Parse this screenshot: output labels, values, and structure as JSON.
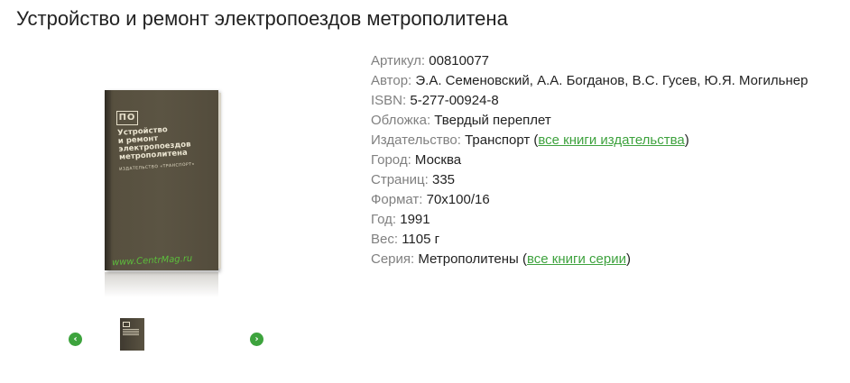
{
  "page": {
    "title": "Устройство и ремонт электропоездов метрополитена"
  },
  "cover": {
    "logo_text": "ПО",
    "title_lines": [
      "Устройство",
      "и ремонт",
      "электропоездов",
      "метрополитена"
    ],
    "publisher": "ИЗДАТЕЛЬСТВО «ТРАНСПОРТ»",
    "watermark": "www.CentrMag.ru"
  },
  "gallery": {
    "prev_icon": "chevron-left-icon",
    "next_icon": "chevron-right-icon",
    "prev_glyph": "‹",
    "next_glyph": "›"
  },
  "attributes": {
    "article": {
      "label": "Артикул:",
      "value": "00810077"
    },
    "author": {
      "label": "Автор:",
      "value": "Э.А. Семеновский, А.А. Богданов, В.С. Гусев, Ю.Я. Могильнер"
    },
    "isbn": {
      "label": "ISBN:",
      "value": "5-277-00924-8"
    },
    "cover": {
      "label": "Обложка:",
      "value": "Твердый переплет"
    },
    "publisher": {
      "label": "Издательство:",
      "value": "Транспорт",
      "link": "все книги издательства"
    },
    "city": {
      "label": "Город:",
      "value": "Москва"
    },
    "pages": {
      "label": "Страниц:",
      "value": "335"
    },
    "format": {
      "label": "Формат:",
      "value": "70x100/16"
    },
    "year": {
      "label": "Год:",
      "value": "1991"
    },
    "weight": {
      "label": "Вес:",
      "value": "1105 г"
    },
    "series": {
      "label": "Серия:",
      "value": "Метрополитены",
      "link": "все книги серии"
    }
  },
  "colors": {
    "link": "#3ea23e",
    "label": "#808080",
    "cover": "#5b5443"
  }
}
